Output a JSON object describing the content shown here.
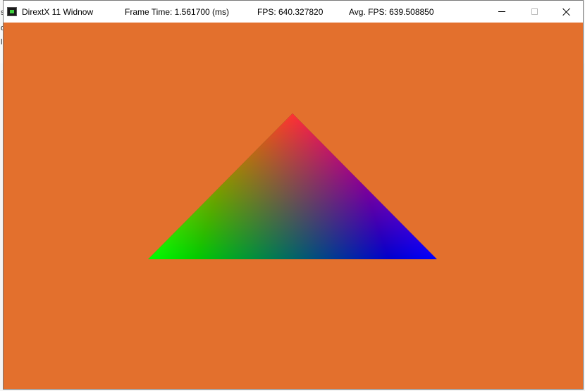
{
  "window": {
    "title": "DirextX 11 Widnow",
    "frame_time": "Frame Time: 1.561700 (ms)",
    "fps": "FPS: 640.327820",
    "avg_fps": "Avg. FPS: 639.508850"
  },
  "background_fragments": [
    "s",
    "d",
    "l"
  ],
  "colors": {
    "clear_color": "#e3702d",
    "vertex_top": "#ff0000",
    "vertex_left": "#00ff00",
    "vertex_right": "#0000ff"
  },
  "icons": {
    "app": "directx-app-icon",
    "minimize": "minimize-icon",
    "maximize": "maximize-icon",
    "close": "close-icon"
  }
}
